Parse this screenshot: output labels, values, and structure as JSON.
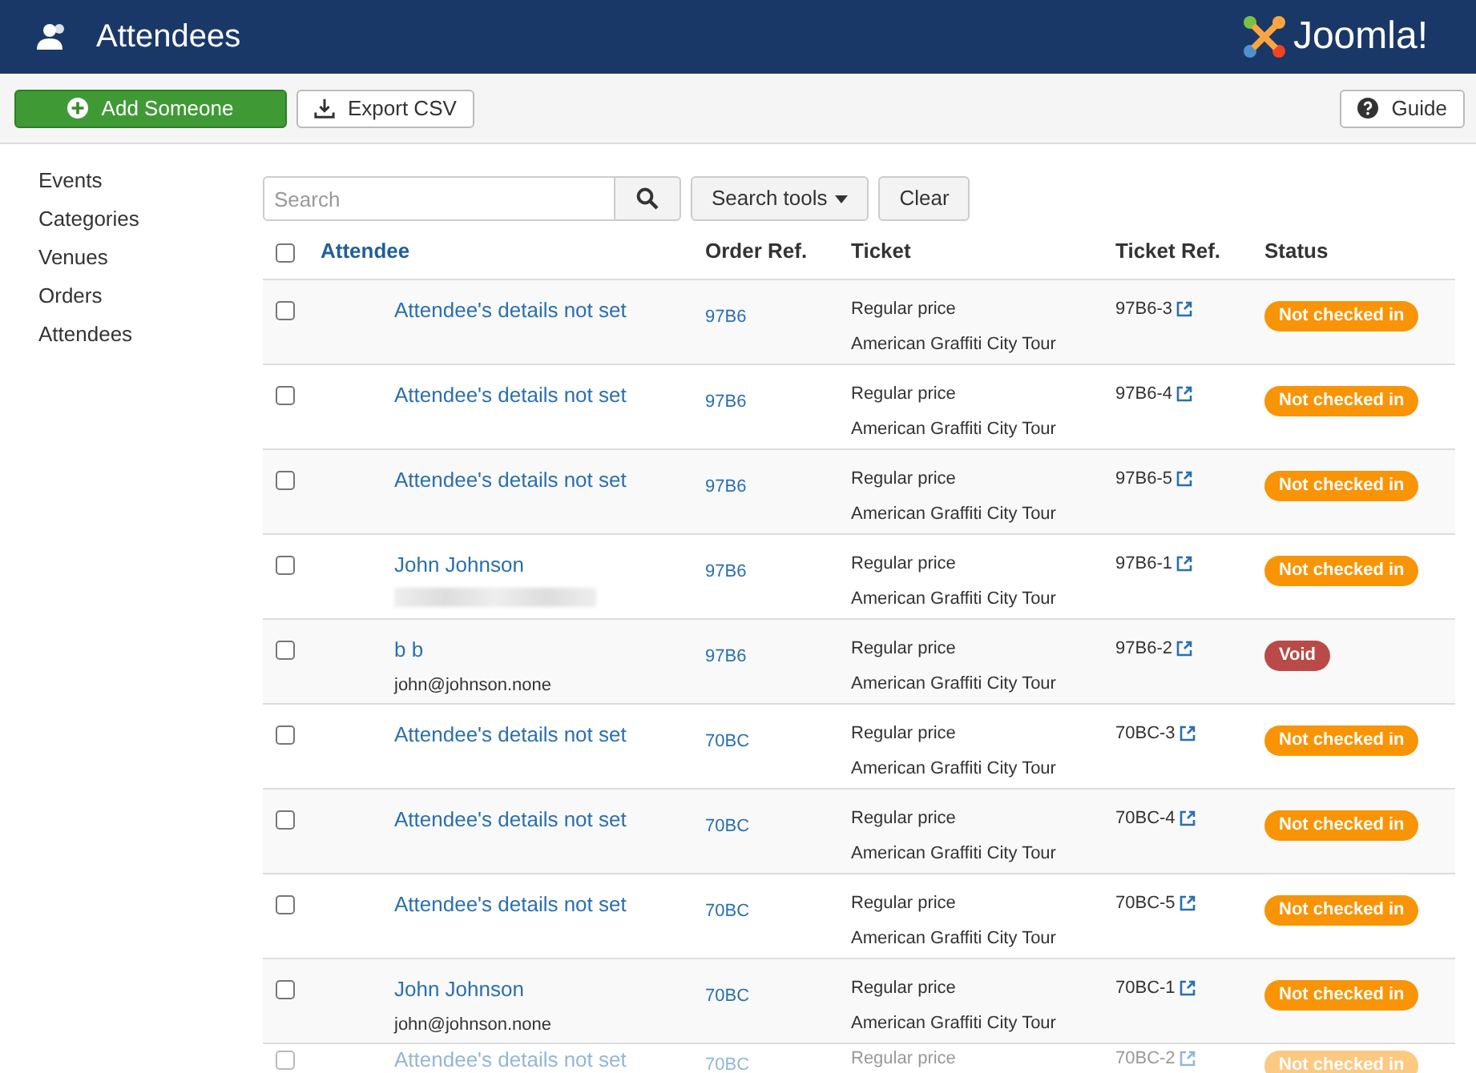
{
  "header": {
    "title": "Attendees",
    "logo_text": "Joomla!"
  },
  "toolbar": {
    "left_buttons": [
      {
        "label": "Add Someone",
        "kind": "primary"
      },
      {
        "label": "Export CSV",
        "kind": "export"
      }
    ],
    "right_button": {
      "label": "Guide"
    }
  },
  "sidebar": {
    "items": [
      {
        "label": "Events",
        "selected": false
      },
      {
        "label": "Categories",
        "selected": false
      },
      {
        "label": "Venues",
        "selected": false
      },
      {
        "label": "Orders",
        "selected": false
      },
      {
        "label": "Attendees",
        "selected": false
      }
    ]
  },
  "filters": {
    "search": {
      "placeholder": "Search"
    },
    "search_tools": "Search tools",
    "clear": "Clear"
  },
  "table": {
    "columns": [
      "Attendee",
      "Order Ref.",
      "Ticket",
      "Ticket Ref.",
      "Status"
    ],
    "select_all_checked": false,
    "rows": [
      {
        "checked": false,
        "name": "Attendee's details not set",
        "email_redacted": false,
        "order": "97B6",
        "ticket": "Regular price",
        "event": "American Graffiti City Tour",
        "ticket_ref": "97B6-3",
        "status": "Not checked in",
        "kind": "pending"
      },
      {
        "checked": false,
        "name": "Attendee's details not set",
        "email_redacted": false,
        "order": "97B6",
        "ticket": "Regular price",
        "event": "American Graffiti City Tour",
        "ticket_ref": "97B6-4",
        "status": "Not checked in",
        "kind": "pending"
      },
      {
        "checked": false,
        "name": "Attendee's details not set",
        "email_redacted": false,
        "order": "97B6",
        "ticket": "Regular price",
        "event": "American Graffiti City Tour",
        "ticket_ref": "97B6-5",
        "status": "Not checked in",
        "kind": "pending"
      },
      {
        "checked": false,
        "name": "John Johnson",
        "email_redacted": true,
        "order": "97B6",
        "ticket": "Regular price",
        "event": "American Graffiti City Tour",
        "ticket_ref": "97B6-1",
        "status": "Not checked in",
        "kind": "pending"
      },
      {
        "checked": false,
        "name": "b b",
        "email": "john@johnson.none",
        "email_redacted": false,
        "order": "97B6",
        "ticket": "Regular price",
        "event": "American Graffiti City Tour",
        "ticket_ref": "97B6-2",
        "status": "Void",
        "kind": "void"
      },
      {
        "checked": false,
        "name": "Attendee's details not set",
        "email_redacted": false,
        "order": "70BC",
        "ticket": "Regular price",
        "event": "American Graffiti City Tour",
        "ticket_ref": "70BC-3",
        "status": "Not checked in",
        "kind": "pending"
      },
      {
        "checked": false,
        "name": "Attendee's details not set",
        "email_redacted": false,
        "order": "70BC",
        "ticket": "Regular price",
        "event": "American Graffiti City Tour",
        "ticket_ref": "70BC-4",
        "status": "Not checked in",
        "kind": "pending"
      },
      {
        "checked": false,
        "name": "Attendee's details not set",
        "email_redacted": false,
        "order": "70BC",
        "ticket": "Regular price",
        "event": "American Graffiti City Tour",
        "ticket_ref": "70BC-5",
        "status": "Not checked in",
        "kind": "pending"
      },
      {
        "checked": false,
        "name": "John Johnson",
        "email": "john@johnson.none",
        "email_redacted": false,
        "order": "70BC",
        "ticket": "Regular price",
        "event": "American Graffiti City Tour",
        "ticket_ref": "70BC-1",
        "status": "Not checked in",
        "kind": "pending"
      },
      {
        "checked": false,
        "name": "Attendee's details not set",
        "email_redacted": false,
        "order": "70BC",
        "ticket": "Regular price",
        "ticket_ref": "70BC-2",
        "status": "Not checked in",
        "kind": "pending"
      }
    ]
  }
}
